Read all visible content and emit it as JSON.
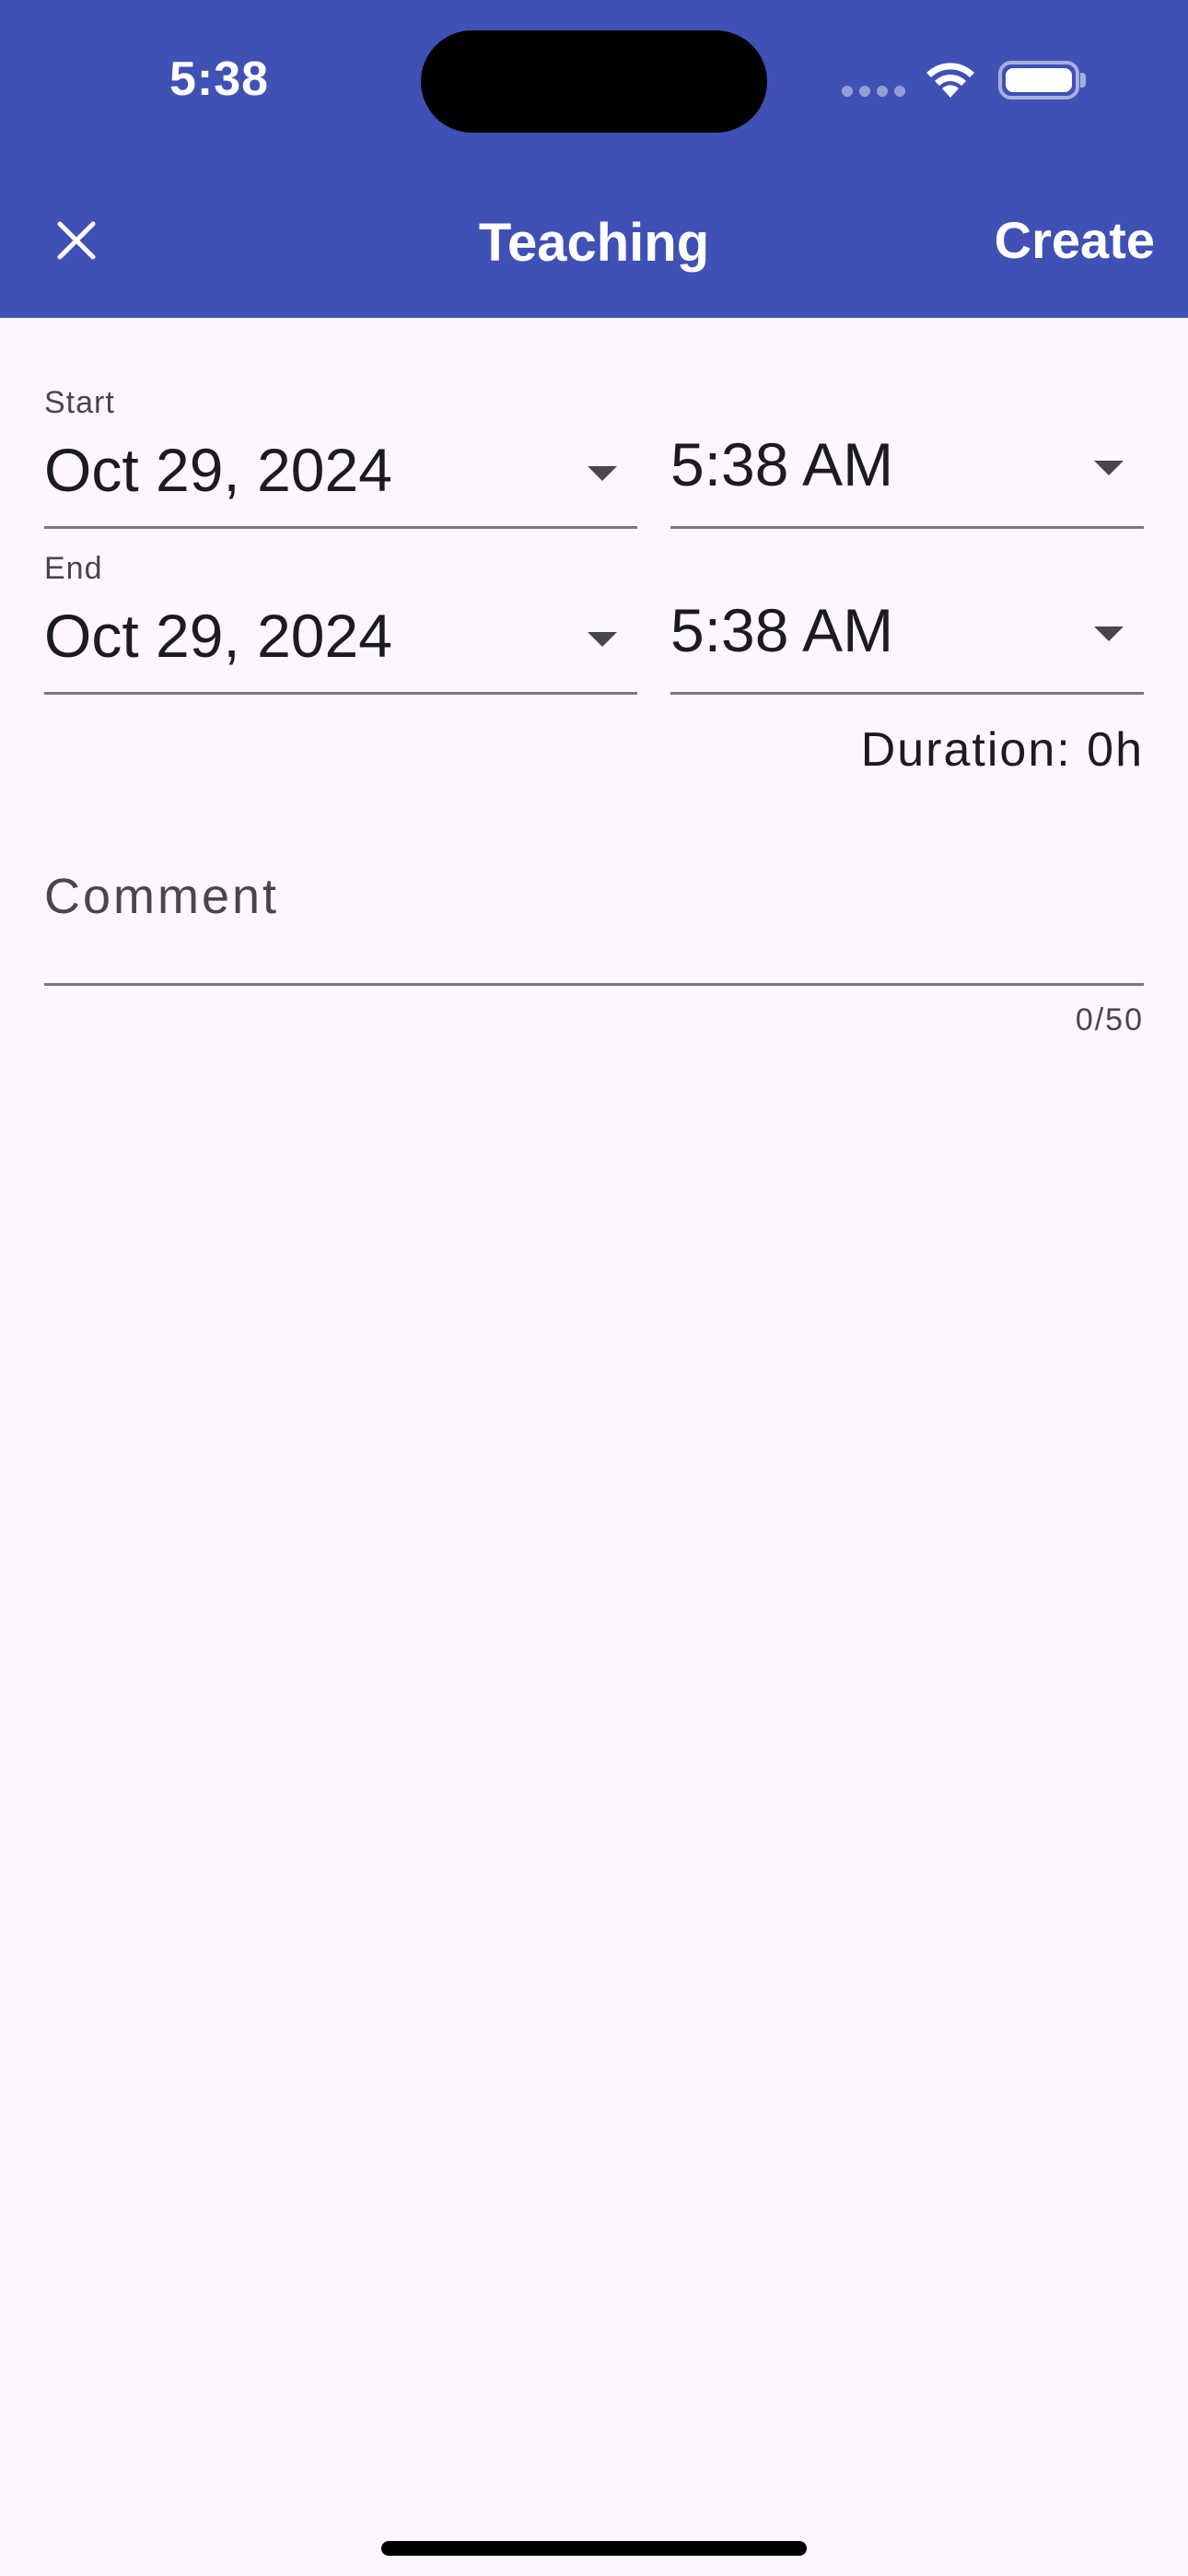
{
  "status_bar": {
    "time": "5:38",
    "icons": [
      "cellular-signal-icon",
      "wifi-icon",
      "battery-icon"
    ]
  },
  "app_bar": {
    "close_icon": "close-icon",
    "title": "Teaching",
    "create_label": "Create",
    "background_color": "#3f51b5"
  },
  "form": {
    "start": {
      "label": "Start",
      "date": "Oct 29, 2024",
      "time": "5:38 AM"
    },
    "end": {
      "label": "End",
      "date": "Oct 29, 2024",
      "time": "5:38 AM"
    },
    "duration": "Duration: 0h",
    "comment": {
      "placeholder": "Comment",
      "value": "",
      "counter": "0/50"
    }
  }
}
